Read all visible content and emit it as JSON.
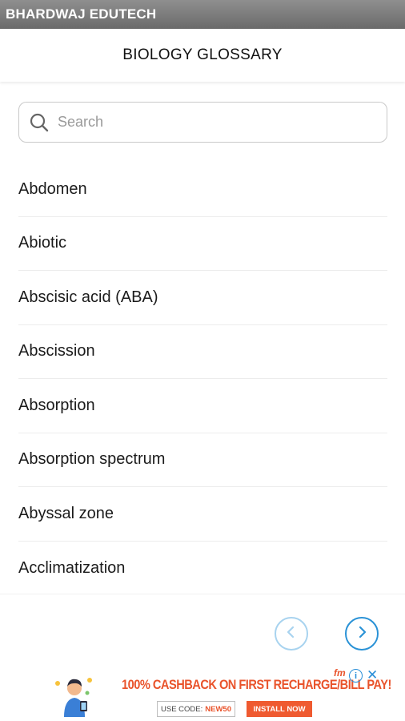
{
  "titlebar": {
    "label": "BHARDWAJ EDUTECH"
  },
  "header": {
    "title": "BIOLOGY GLOSSARY"
  },
  "search": {
    "placeholder": "Search",
    "value": ""
  },
  "glossary": {
    "items": [
      {
        "label": "Abdomen"
      },
      {
        "label": "Abiotic"
      },
      {
        "label": "Abscisic acid (ABA)"
      },
      {
        "label": "Abscission"
      },
      {
        "label": "Absorption"
      },
      {
        "label": "Absorption spectrum"
      },
      {
        "label": "Abyssal zone"
      },
      {
        "label": "Acclimatization"
      }
    ]
  },
  "navigation": {
    "prev_icon": "chevron-left-icon",
    "next_icon": "chevron-right-icon"
  },
  "ad": {
    "headline": "100% CASHBACK ON FIRST RECHARGE/BILL PAY!",
    "code_label": "USE CODE:",
    "code_value": "NEW50",
    "install_label": "INSTALL NOW",
    "brand": "fm",
    "info_icon": "info-icon",
    "close_icon": "close-icon"
  },
  "colors": {
    "titlebar": "#7a7a7a",
    "accent_blue": "#2a92d6",
    "accent_blue_light": "#a8d3ef",
    "ad_orange": "#ef5a30"
  }
}
